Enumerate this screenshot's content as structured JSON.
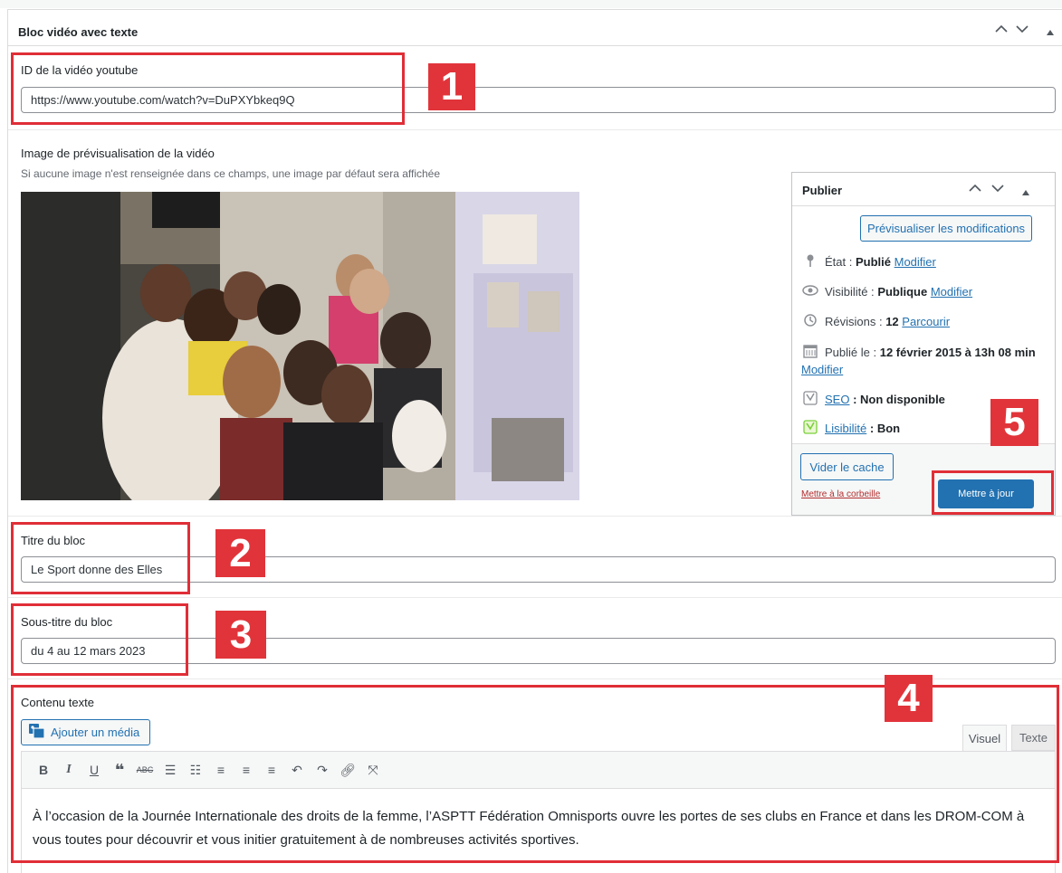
{
  "panel": {
    "title": "Bloc vidéo avec texte"
  },
  "fields": {
    "video_id": {
      "label": "ID de la vidéo youtube",
      "value": "https://www.youtube.com/watch?v=DuPXYbkeq9Q"
    },
    "preview": {
      "label": "Image de prévisualisation de la vidéo",
      "description": "Si aucune image n'est renseignée dans ce champs, une image par défaut sera affichée"
    },
    "title": {
      "label": "Titre du bloc",
      "value": "Le Sport donne des Elles"
    },
    "subtitle": {
      "label": "Sous-titre du bloc",
      "value": "du 4 au 12 mars 2023"
    },
    "content": {
      "label": "Contenu texte",
      "add_media": "Ajouter un média",
      "tab_visual": "Visuel",
      "tab_text": "Texte",
      "text": "À l’occasion de la Journée Internationale des droits de la femme, l’ASPTT Fédération Omnisports ouvre les portes de ses clubs en France et dans les DROM-COM à vous toutes pour découvrir et vous initier gratuitement à de nombreuses activités sportives."
    }
  },
  "publish": {
    "title": "Publier",
    "preview_button": "Prévisualiser les modifications",
    "status_label": "État :",
    "status_value": "Publié",
    "status_link": "Modifier",
    "visibility_label": "Visibilité :",
    "visibility_value": "Publique",
    "visibility_link": "Modifier",
    "revisions_label": "Révisions :",
    "revisions_value": "12",
    "revisions_link": "Parcourir",
    "published_label": "Publié le :",
    "published_value": "12 février 2015 à 13h 08 min",
    "published_link": "Modifier",
    "seo_link": "SEO",
    "seo_value": ": Non disponible",
    "readability_link": "Lisibilité",
    "readability_value": ": Bon",
    "clear_cache": "Vider le cache",
    "trash": "Mettre à la corbeille",
    "update": "Mettre à jour"
  },
  "annotations": [
    "1",
    "2",
    "3",
    "4",
    "5"
  ],
  "icons": {
    "panel_controls": [
      "chevron-up-icon",
      "chevron-down-icon",
      "triangle-up-icon"
    ],
    "toolbar": [
      "bold-icon",
      "italic-icon",
      "underline-icon",
      "blockquote-icon",
      "strikethrough-icon",
      "bullet-list-icon",
      "numbered-list-icon",
      "align-left-icon",
      "align-center-icon",
      "align-right-icon",
      "undo-icon",
      "redo-icon",
      "link-icon",
      "fullscreen-icon"
    ]
  },
  "colors": {
    "accent": "#2271b1",
    "annotation_red": "#e1343a"
  }
}
